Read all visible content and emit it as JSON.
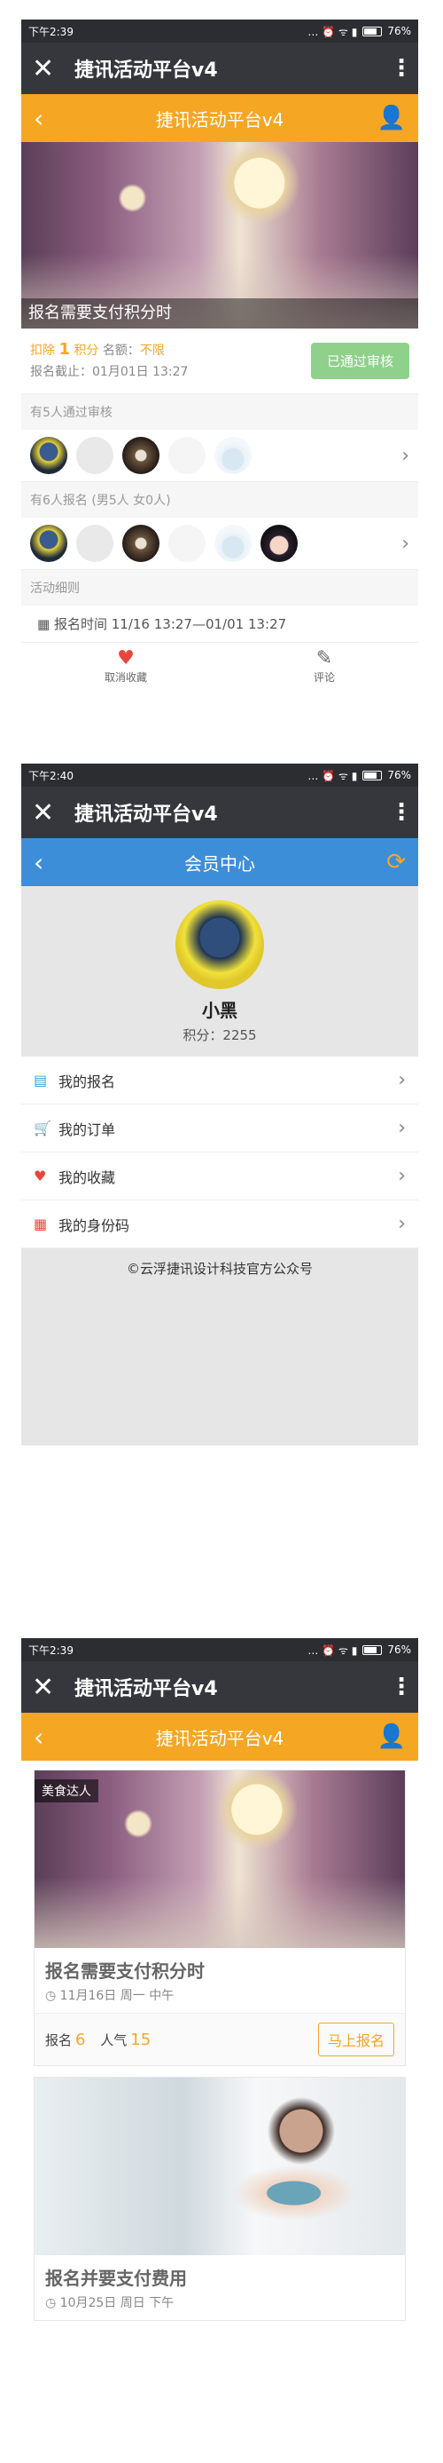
{
  "screen1": {
    "status": {
      "time": "下午2:39",
      "battery": "76%"
    },
    "appbar": {
      "title": "捷讯活动平台v4"
    },
    "nav": {
      "title": "捷讯活动平台v4"
    },
    "banner": {
      "caption": "报名需要支付积分时"
    },
    "info": {
      "deduct_label": "扣除",
      "deduct_value": "1",
      "deduct_unit": "积分",
      "quota_label": "名额：",
      "quota_value": "不限",
      "deadline": "报名截止：01月01日 13:27",
      "status_button": "已通过审核"
    },
    "approved_label": "有5人通过审核",
    "registered_label": "有6人报名 (男5人 女0人)",
    "rules_label": "活动细则",
    "time_text": "报名时间 11/16 13:27—01/01 13:27",
    "bottom": {
      "fav_label": "取消收藏",
      "comment_label": "评论"
    }
  },
  "screen2": {
    "status": {
      "time": "下午2:40",
      "battery": "76%"
    },
    "appbar": {
      "title": "捷讯活动平台v4"
    },
    "nav": {
      "title": "会员中心"
    },
    "profile": {
      "name": "小黑",
      "points": "积分：2255"
    },
    "menu": [
      {
        "label": "我的报名"
      },
      {
        "label": "我的订单"
      },
      {
        "label": "我的收藏"
      },
      {
        "label": "我的身份码"
      }
    ],
    "footer": "©云浮捷讯设计科技官方公众号"
  },
  "screen3": {
    "status": {
      "time": "下午2:39",
      "battery": "76%"
    },
    "appbar": {
      "title": "捷讯活动平台v4"
    },
    "nav": {
      "title": "捷讯活动平台v4"
    },
    "cards": [
      {
        "tag": "美食达人",
        "title": "报名需要支付积分时",
        "date": "11月16日 周一 中午",
        "signup_label": "报名",
        "signup_count": "6",
        "pop_label": "人气",
        "pop_count": "15",
        "button": "马上报名"
      },
      {
        "title": "报名并要支付费用",
        "date": "10月25日 周日 下午"
      }
    ]
  }
}
